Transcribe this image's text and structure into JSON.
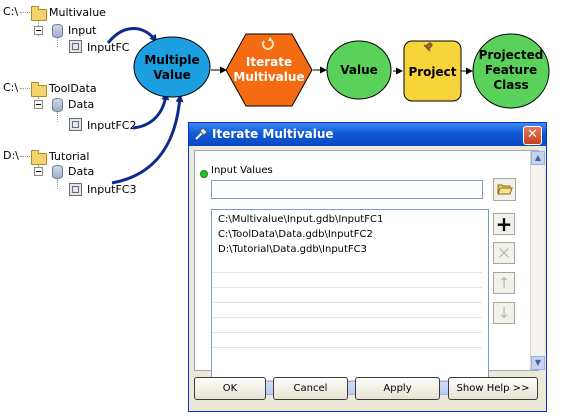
{
  "tree": {
    "group1": {
      "drive": "C:\\",
      "folder": "Multivalue",
      "gdb": "Input",
      "fc": "InputFC"
    },
    "group2": {
      "drive": "C:\\",
      "folder": "ToolData",
      "gdb": "Data",
      "fc": "InputFC2"
    },
    "group3": {
      "drive": "D:\\",
      "folder": "Tutorial",
      "gdb": "Data",
      "fc": "InputFC3"
    }
  },
  "model": {
    "multiple_value": {
      "line1": "Multiple",
      "line2": "Value"
    },
    "iterate": {
      "line1": "Iterate",
      "line2": "Multivalue"
    },
    "value": "Value",
    "project": "Project",
    "output": {
      "line1": "Projected",
      "line2": "Feature",
      "line3": "Class"
    },
    "colors": {
      "multiple_value_fill": "#1c9fe1",
      "iterate_fill": "#f56b12",
      "value_fill": "#5ad15a",
      "project_fill": "#f7d43a",
      "output_fill": "#5ad15a",
      "arrow": "#0f2a8c"
    }
  },
  "dialog": {
    "title": "Iterate Multivalue",
    "close_glyph": "✕",
    "input_values_label": "Input Values",
    "input_value": "",
    "list_items": [
      "C:\\Multivalue\\Input.gdb\\InputFC1",
      "C:\\ToolData\\Data.gdb\\InputFC2",
      "D:\\Tutorial\\Data.gdb\\InputFC3"
    ],
    "buttons": {
      "ok": "OK",
      "cancel": "Cancel",
      "apply": "Apply",
      "show_help": "Show Help >>"
    },
    "side_buttons": {
      "add": "+",
      "remove": "×",
      "up": "↑",
      "down": "↓",
      "browse": "folder-open-icon"
    },
    "scroll_glyphs": {
      "left": "◀",
      "right": "▶",
      "up": "▲",
      "down": "▼",
      "thumb": "|||"
    }
  }
}
